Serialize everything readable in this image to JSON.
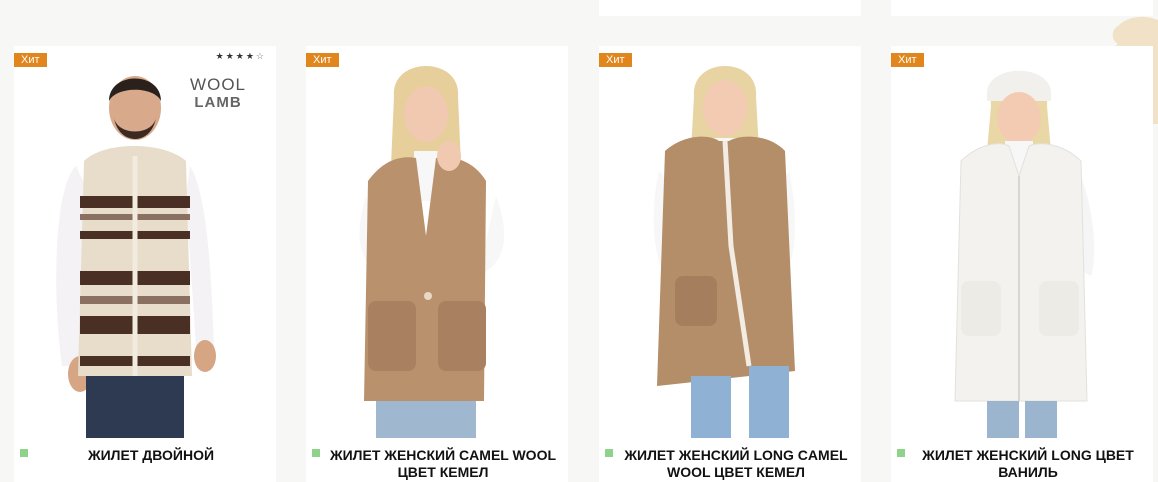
{
  "products": [
    {
      "badge": "Хит",
      "rating_filled": "★★★★",
      "rating_empty": "☆",
      "logo_line1": "WOOL",
      "logo_line2": "LAMB",
      "title": "Жилет двойной",
      "vest_color": "#e8dccb"
    },
    {
      "badge": "Хит",
      "title": "Жилет женский Camel Wool цвет кемел",
      "vest_color": "#b9916c"
    },
    {
      "badge": "Хит",
      "title": "Жилет женский Long Camel Wool цвет кемел",
      "vest_color": "#b48d69"
    },
    {
      "badge": "Хит",
      "title": "Жилет женский Long цвет ваниль",
      "vest_color": "#f3f2ee"
    }
  ],
  "colors": {
    "badge": "#e0861c",
    "availability": "#8fd38a",
    "background": "#f7f7f5",
    "deco": "#f1e1c6"
  }
}
